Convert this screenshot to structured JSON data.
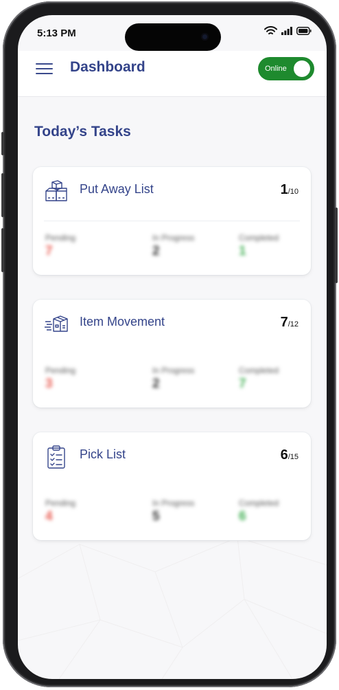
{
  "status": {
    "time": "5:13 PM"
  },
  "header": {
    "title": "Dashboard",
    "toggle_label": "Online"
  },
  "section": {
    "title": "Today’s Tasks"
  },
  "colors": {
    "brand": "#34448a",
    "online": "#1e8a2e",
    "pending": "#e85a50",
    "completed": "#3fae52"
  },
  "tasks": [
    {
      "name": "Put Away List",
      "icon": "boxes-icon",
      "count": "1",
      "total": "/10",
      "pending_label": "Pending",
      "pending": "7",
      "progress_label": "In Progress",
      "progress": "2",
      "completed_label": "Completed",
      "completed": "1"
    },
    {
      "name": "Item Movement",
      "icon": "moving-box-icon",
      "count": "7",
      "total": "/12",
      "pending_label": "Pending",
      "pending": "3",
      "progress_label": "In Progress",
      "progress": "2",
      "completed_label": "Completed",
      "completed": "7"
    },
    {
      "name": "Pick List",
      "icon": "clipboard-list-icon",
      "count": "6",
      "total": "/15",
      "pending_label": "Pending",
      "pending": "4",
      "progress_label": "In Progress",
      "progress": "5",
      "completed_label": "Completed",
      "completed": "6"
    }
  ]
}
